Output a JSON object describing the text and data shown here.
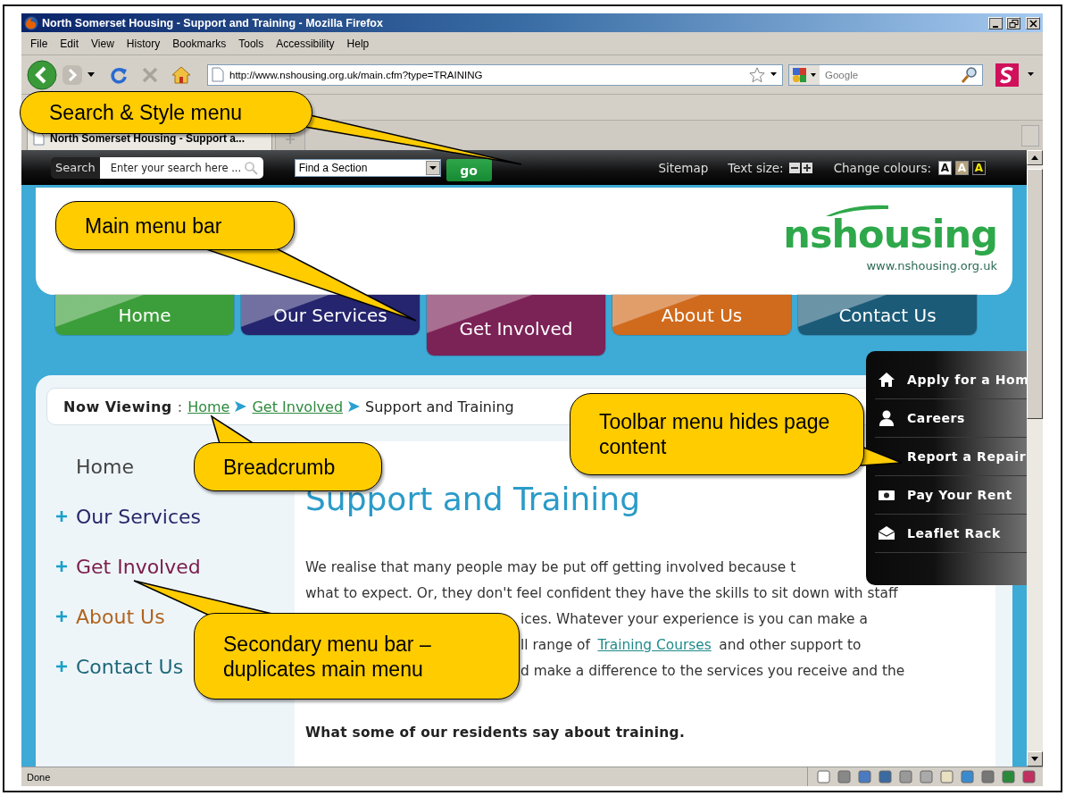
{
  "browser": {
    "title": "North Somerset Housing - Support and Training - Mozilla Firefox",
    "menu": [
      "File",
      "Edit",
      "View",
      "History",
      "Bookmarks",
      "Tools",
      "Accessibility",
      "Help"
    ],
    "url": "http://www.nshousing.org.uk/main.cfm?type=TRAINING",
    "search_placeholder": "Google",
    "tabs": [
      {
        "label": "North Somerset Housing - Support a...",
        "selected": true
      }
    ],
    "status": "Done"
  },
  "site": {
    "top_bar": {
      "search_label": "Search",
      "search_placeholder": "Enter your search here ...",
      "section_select": "Find a Section",
      "go": "go",
      "sitemap": "Sitemap",
      "text_size": "Text size:",
      "change_colours": "Change colours:",
      "colour_options": [
        {
          "label": "A",
          "color": "#ffffff",
          "kind": "light"
        },
        {
          "label": "A",
          "color": "#b5a27c",
          "kind": "tan"
        },
        {
          "label": "A",
          "color": "#111111",
          "kind": "dark"
        }
      ]
    },
    "logo": {
      "name": "nshousing",
      "url": "www.nshousing.org.uk"
    },
    "main_menu": [
      {
        "label": "Home",
        "color": "#3c9e3a",
        "selected": false
      },
      {
        "label": "Our Services",
        "color": "#25246e",
        "selected": false
      },
      {
        "label": "Get Involved",
        "color": "#7b2257",
        "selected": true
      },
      {
        "label": "About Us",
        "color": "#d06a1c",
        "selected": false
      },
      {
        "label": "Contact Us",
        "color": "#1b5b78",
        "selected": false
      }
    ],
    "breadcrumb": {
      "label": "Now Viewing",
      "separator": ":",
      "links": [
        "Home",
        "Get Involved"
      ],
      "current": "Support and Training"
    },
    "side_menu": [
      {
        "label": "Home",
        "expandable": false,
        "color": "#444444"
      },
      {
        "label": "Our Services",
        "expandable": true,
        "color": "#27276a"
      },
      {
        "label": "Get Involved",
        "expandable": true,
        "color": "#7a1c4a"
      },
      {
        "label": "About Us",
        "expandable": true,
        "color": "#b0641f"
      },
      {
        "label": "Contact Us",
        "expandable": true,
        "color": "#1d6878"
      }
    ],
    "heading": "Support and Training",
    "paragraph_lines": [
      {
        "kind": "full",
        "segments": [
          {
            "text": "We realise that many people may be put off getting involved because t",
            "link": false
          }
        ]
      },
      {
        "kind": "full",
        "segments": [
          {
            "text": "what to expect. Or, they don't feel confident they have the skills to sit down with staff",
            "link": false
          }
        ]
      },
      {
        "kind": "partial",
        "segments": [
          {
            "text": "ices.  Whatever your experience is you can make a",
            "link": false
          }
        ]
      },
      {
        "kind": "partial",
        "segments": [
          {
            "text": "ll range of",
            "link": false
          },
          {
            "text": "Training Courses",
            "link": true
          },
          {
            "text": "and other support to",
            "link": false
          }
        ]
      },
      {
        "kind": "partial",
        "segments": [
          {
            "text": "d make a difference to the services you receive and the",
            "link": false
          }
        ]
      }
    ],
    "subheading": "What some of our residents say about training.",
    "quick_links": [
      {
        "label": "Apply for a Hom",
        "kind": "home"
      },
      {
        "label": "Careers",
        "kind": "person"
      },
      {
        "label": "Report a Repair",
        "kind": "repair"
      },
      {
        "label": "Pay Your Rent",
        "kind": "rent"
      },
      {
        "label": "Leaflet Rack",
        "kind": "leaflet"
      }
    ]
  },
  "callouts": [
    {
      "text": "Search & Style menu"
    },
    {
      "text": "Main menu bar"
    },
    {
      "text": "Breadcrumb"
    },
    {
      "text": "Toolbar menu hides page content"
    },
    {
      "text": "Secondary menu bar – duplicates main menu"
    }
  ]
}
